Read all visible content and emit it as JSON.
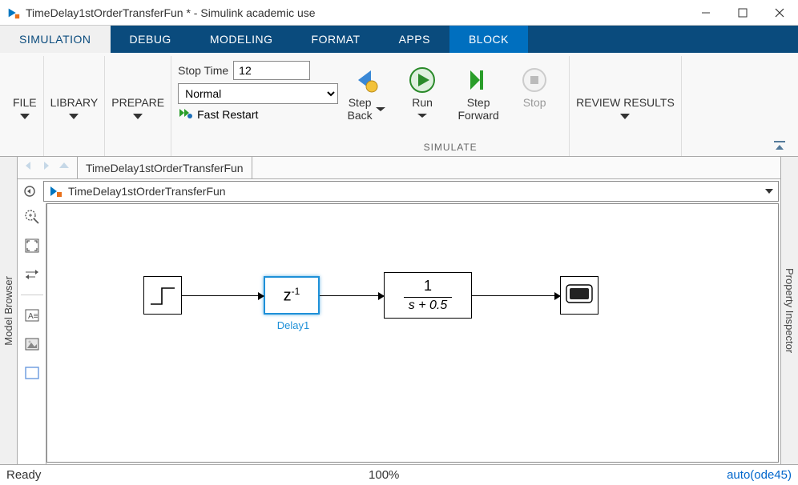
{
  "window": {
    "title": "TimeDelay1stOrderTransferFun *  -  Simulink academic use"
  },
  "tabs": {
    "items": [
      "SIMULATION",
      "DEBUG",
      "MODELING",
      "FORMAT",
      "APPS",
      "BLOCK"
    ],
    "active_index": 0,
    "highlight_index": 5
  },
  "ribbon": {
    "file": "FILE",
    "library": "LIBRARY",
    "prepare": "PREPARE",
    "stop_time_label": "Stop Time",
    "stop_time_value": "12",
    "sim_mode": "Normal",
    "fast_restart": "Fast Restart",
    "step_back": "Step\nBack",
    "run": "Run",
    "step_forward": "Step\nForward",
    "stop": "Stop",
    "review": "REVIEW RESULTS",
    "simulate_caption": "SIMULATE"
  },
  "navigation": {
    "crumb": "TimeDelay1stOrderTransferFun",
    "path": "TimeDelay1stOrderTransferFun"
  },
  "side": {
    "left": "Model Browser",
    "right": "Property Inspector"
  },
  "blocks": {
    "delay_text": "z",
    "delay_sup": "-1",
    "delay_label": "Delay1",
    "tf_num": "1",
    "tf_den": "s + 0.5"
  },
  "status": {
    "left": "Ready",
    "center": "100%",
    "right": "auto(ode45)"
  }
}
